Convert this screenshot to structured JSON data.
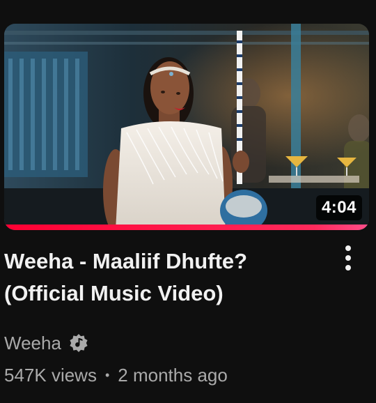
{
  "video": {
    "duration": "4:04",
    "watch_progress": 1.0,
    "title": "Weeha - Maaliif Dhufte? (Official Music Video)",
    "channel": "Weeha",
    "views": "547K views",
    "separator": "•",
    "published": "2 months ago"
  },
  "icons": {
    "more": "more-vert-icon",
    "verified": "music-artist-badge-icon"
  },
  "colors": {
    "background": "#0f0f0f",
    "title": "#f1f1f1",
    "secondary_text": "#aaaaaa",
    "progress": "#ff0033",
    "duration_bg": "#000000"
  }
}
